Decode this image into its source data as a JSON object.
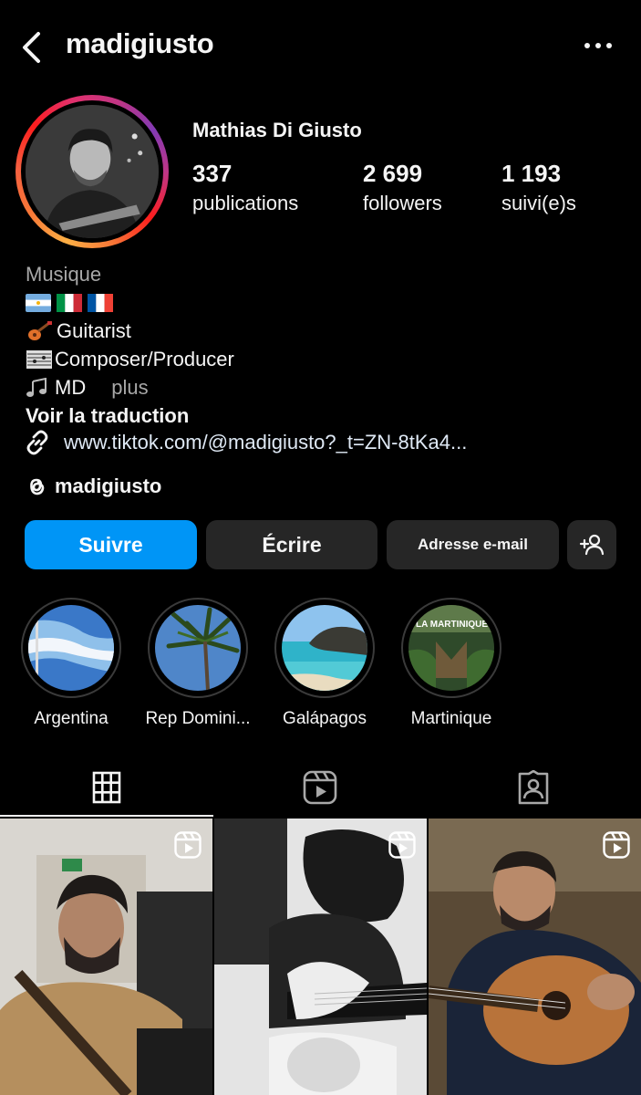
{
  "header": {
    "username": "madigiusto",
    "back_icon": "chevron-left-icon",
    "more_icon": "more-horizontal-icon"
  },
  "profile": {
    "display_name": "Mathias Di Giusto",
    "stats": [
      {
        "value": "337",
        "label": "publications"
      },
      {
        "value": "2 699",
        "label": "followers"
      },
      {
        "value": "1 193",
        "label": "suivi(e)s"
      }
    ]
  },
  "bio": {
    "category": "Musique",
    "lines": [
      "Guitarist",
      "Composer/Producer",
      "MD"
    ],
    "more": "plus",
    "translate": "Voir la traduction",
    "link": "www.tiktok.com/@madigiusto?_t=ZN-8tKa4...",
    "threads_handle": "madigiusto"
  },
  "buttons": {
    "follow": "Suivre",
    "message": "Écrire",
    "email": "Adresse e-mail",
    "add_icon": "add-person-icon"
  },
  "highlights": [
    {
      "label": "Argentina"
    },
    {
      "label": "Rep Domini..."
    },
    {
      "label": "Galápagos"
    },
    {
      "label": "Martinique"
    }
  ],
  "highlight_photo_text": "LA MARTINIQUE",
  "tabs": [
    "grid-icon",
    "reels-icon",
    "tagged-icon"
  ],
  "colors": {
    "accent": "#0095f6",
    "button_bg": "#262626",
    "muted": "#a8a8a8"
  }
}
